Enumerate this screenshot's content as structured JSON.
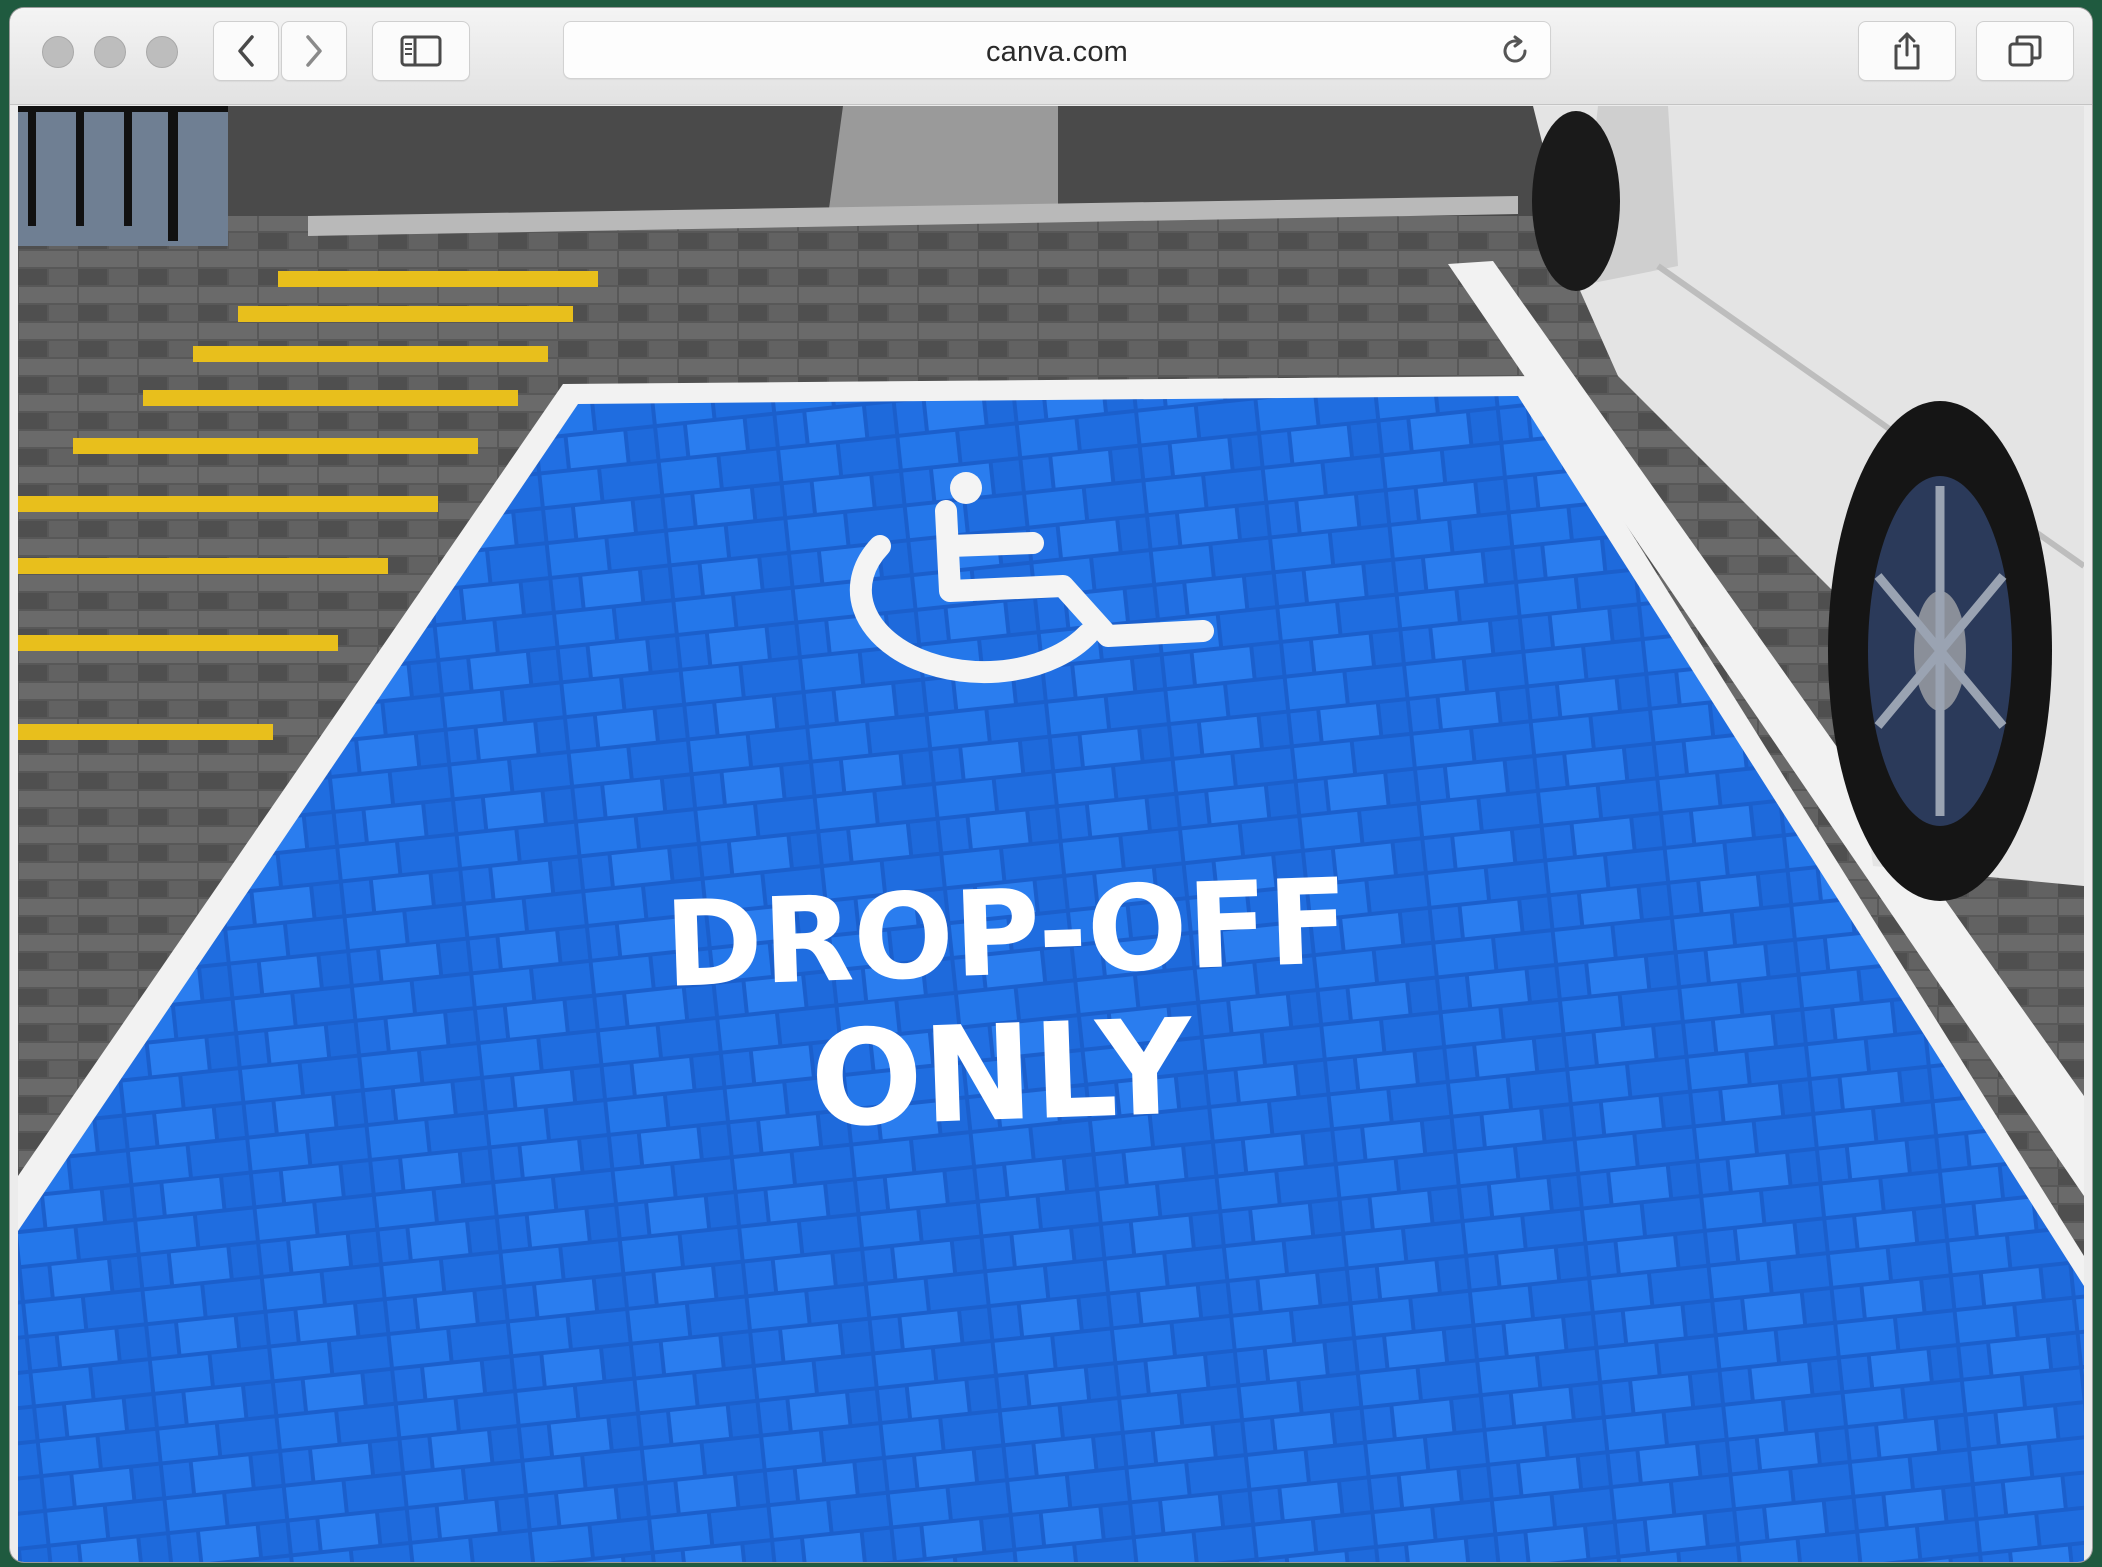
{
  "browser": {
    "url": "canva.com",
    "icons": {
      "back": "chevron-left-icon",
      "forward": "chevron-right-icon",
      "sidebar": "sidebar-icon",
      "reload": "reload-icon",
      "share": "share-icon",
      "tabs": "tabs-icon"
    }
  },
  "photo": {
    "sign_line1": "DROP-OFF",
    "sign_line2": "ONLY",
    "symbol": "wheelchair-icon",
    "colors": {
      "bay_blue": "#1f6fe0",
      "marking_white": "#f4f4f4",
      "hatch_yellow": "#e8bf1c",
      "pavement": "#5a5a5a",
      "car_white": "#e6e6e6"
    }
  }
}
